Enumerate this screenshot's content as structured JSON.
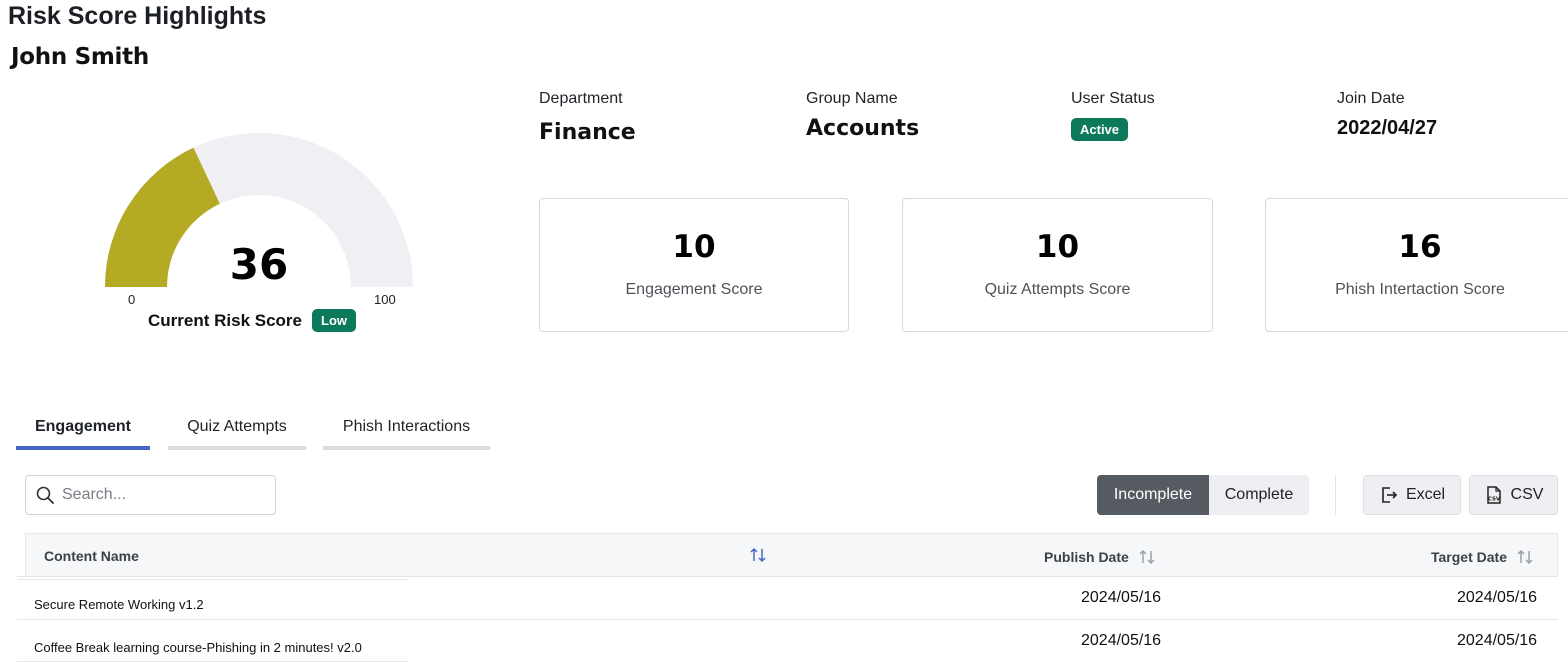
{
  "header": {
    "title": "Risk Score Highlights",
    "user_name": "John Smith"
  },
  "gauge": {
    "value": 36,
    "min": "0",
    "max": "100",
    "label": "Current Risk Score",
    "level_badge": "Low",
    "fill_color": "#b5aa23",
    "track_color": "#efeff4"
  },
  "info": {
    "department_label": "Department",
    "department_value": "Finance",
    "group_label": "Group Name",
    "group_value": "Accounts",
    "status_label": "User Status",
    "status_value": "Active",
    "join_label": "Join Date",
    "join_value": "2022/04/27"
  },
  "scores": [
    {
      "value": "10",
      "caption": "Engagement Score"
    },
    {
      "value": "10",
      "caption": "Quiz Attempts Score"
    },
    {
      "value": "16",
      "caption": "Phish Intertaction Score"
    }
  ],
  "tabs": [
    {
      "label": "Engagement",
      "active": true
    },
    {
      "label": "Quiz Attempts",
      "active": false
    },
    {
      "label": "Phish Interactions",
      "active": false
    }
  ],
  "toolbar": {
    "search_placeholder": "Search...",
    "incomplete_label": "Incomplete",
    "complete_label": "Complete",
    "excel_label": "Excel",
    "csv_label": "CSV",
    "csv_icon_text": "CSV"
  },
  "table": {
    "columns": {
      "content_name": "Content Name",
      "publish_date": "Publish Date",
      "target_date": "Target Date"
    },
    "rows": [
      {
        "name": "Secure Remote Working v1.2",
        "publish": "2024/05/16",
        "target": "2024/05/16"
      },
      {
        "name": "Coffee Break learning course-Phishing in 2 minutes! v2.0",
        "publish": "2024/05/16",
        "target": "2024/05/16"
      }
    ]
  }
}
